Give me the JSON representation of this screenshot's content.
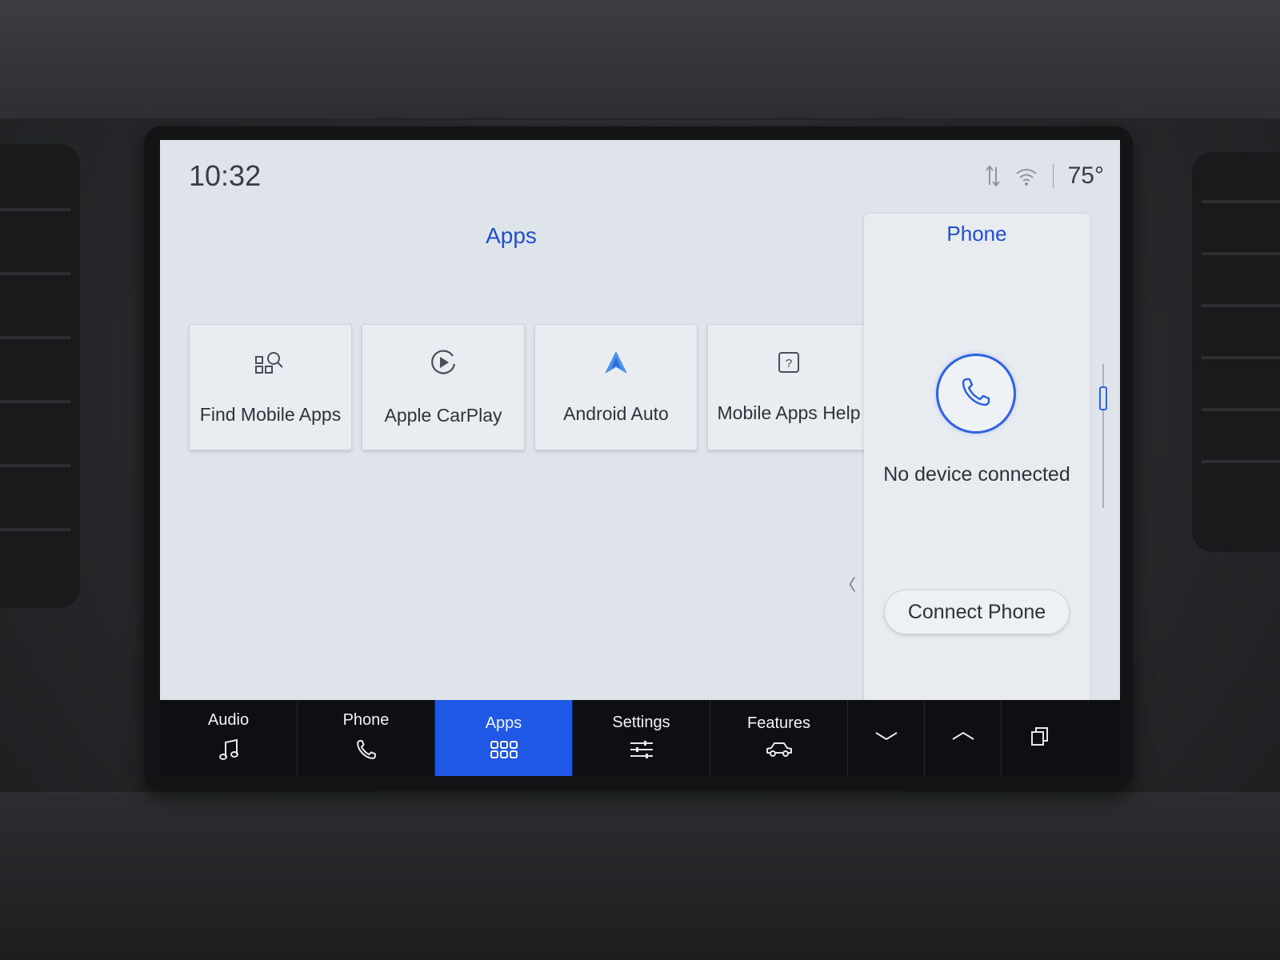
{
  "status_bar": {
    "time": "10:32",
    "temperature": "75°",
    "icons": [
      "data-transfer-icon",
      "wifi-hotspot-icon"
    ]
  },
  "apps_page": {
    "title": "Apps",
    "tiles": [
      {
        "label": "Find Mobile Apps",
        "icon": "app-search-icon"
      },
      {
        "label": "Apple CarPlay",
        "icon": "play-circle-icon"
      },
      {
        "label": "Android Auto",
        "icon": "android-auto-icon"
      },
      {
        "label": "Mobile Apps Help",
        "icon": "help-box-icon"
      }
    ]
  },
  "phone_panel": {
    "title": "Phone",
    "status": "No device connected",
    "connect_label": "Connect Phone",
    "icon": "phone-icon"
  },
  "nav": {
    "items": [
      {
        "label": "Audio",
        "icon": "music-note-icon"
      },
      {
        "label": "Phone",
        "icon": "phone-icon"
      },
      {
        "label": "Apps",
        "icon": "app-grid-icon",
        "active": true
      },
      {
        "label": "Settings",
        "icon": "sliders-icon"
      },
      {
        "label": "Features",
        "icon": "vehicle-icon"
      }
    ],
    "extra_icons": [
      "chevron-down-icon",
      "chevron-up-icon",
      "multi-window-icon"
    ]
  },
  "colors": {
    "accent": "#1f58e6",
    "title_blue": "#1f4fd0",
    "screen_bg": "#dfe3ea",
    "nav_bg": "#0e0f12"
  }
}
